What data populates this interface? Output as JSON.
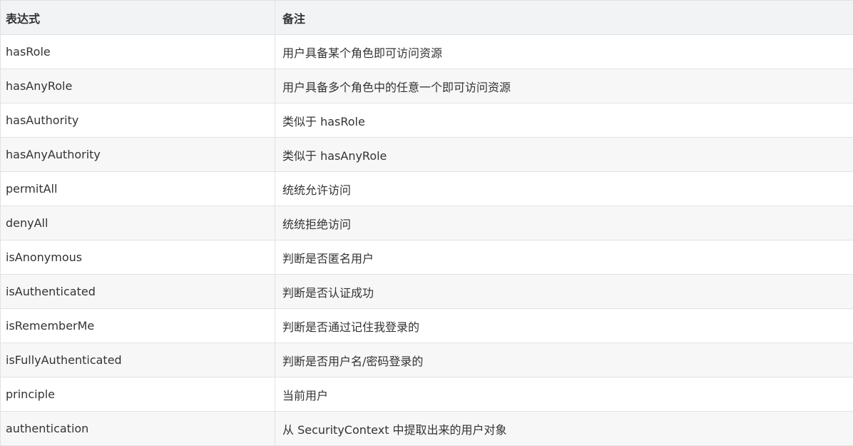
{
  "table": {
    "headers": [
      "表达式",
      "备注"
    ],
    "rows": [
      {
        "expr": "hasRole",
        "note": "用户具备某个角色即可访问资源"
      },
      {
        "expr": "hasAnyRole",
        "note": "用户具备多个角色中的任意一个即可访问资源"
      },
      {
        "expr": "hasAuthority",
        "note": "类似于 hasRole"
      },
      {
        "expr": "hasAnyAuthority",
        "note": "类似于 hasAnyRole"
      },
      {
        "expr": "permitAll",
        "note": "统统允许访问"
      },
      {
        "expr": "denyAll",
        "note": "统统拒绝访问"
      },
      {
        "expr": "isAnonymous",
        "note": "判断是否匿名用户"
      },
      {
        "expr": "isAuthenticated",
        "note": "判断是否认证成功"
      },
      {
        "expr": "isRememberMe",
        "note": "判断是否通过记住我登录的"
      },
      {
        "expr": "isFullyAuthenticated",
        "note": "判断是否用户名/密码登录的"
      },
      {
        "expr": "principle",
        "note": "当前用户"
      },
      {
        "expr": "authentication",
        "note": "从 SecurityContext 中提取出来的用户对象"
      }
    ]
  }
}
